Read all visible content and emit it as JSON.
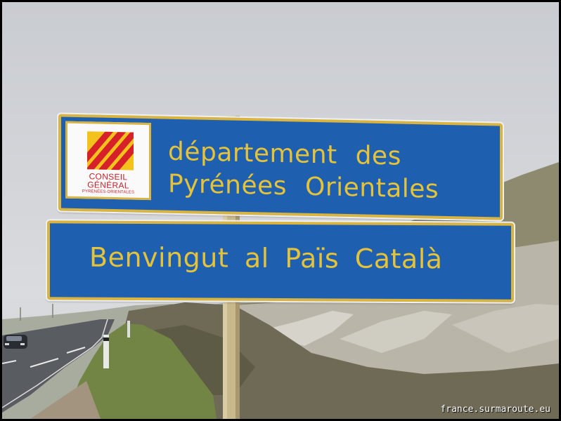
{
  "photo": {
    "description_colors": {
      "sky": "#d3d5d9",
      "sign_blue": "#1f5fb0",
      "sign_yellow": "#e4c33a",
      "logo_red": "#d6202a",
      "logo_yellow": "#f3c21c"
    }
  },
  "sign_top": {
    "line1": "département des",
    "line2": "Pyrénées Orientales",
    "logo": {
      "name_line1": "CONSEIL",
      "name_line2": "GÉNÉRAL",
      "name_line3": "PYRÉNÉES-ORIENTALES"
    }
  },
  "sign_bottom": {
    "line1": "Benvingut al Païs Català"
  },
  "watermark": "france.surmaroute.eu"
}
